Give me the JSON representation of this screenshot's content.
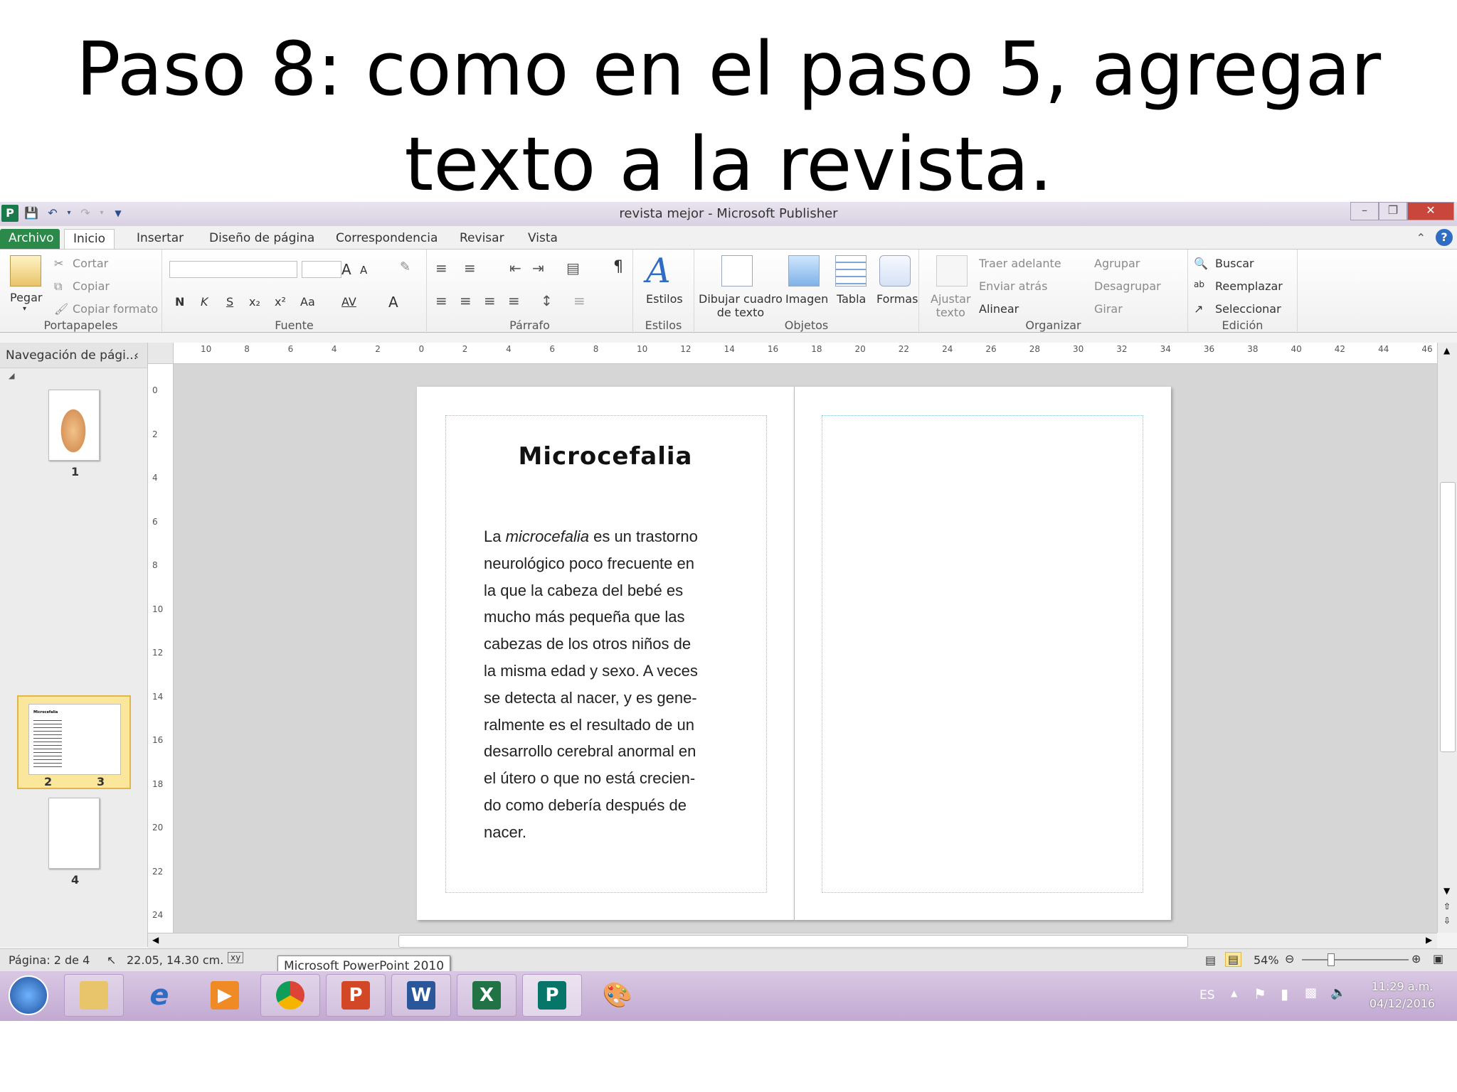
{
  "slide": {
    "title_line1": "Paso 8: como en el paso 5, agregar",
    "title_line2": "texto a la revista."
  },
  "window": {
    "title": "revista mejor  -  Microsoft Publisher"
  },
  "tabs": [
    "Archivo",
    "Inicio",
    "Insertar",
    "Diseño de página",
    "Correspondencia",
    "Revisar",
    "Vista"
  ],
  "ribbon": {
    "portapapeles": {
      "label": "Portapapeles",
      "pegar": "Pegar",
      "cortar": "Cortar",
      "copiar": "Copiar",
      "copiar_formato": "Copiar formato"
    },
    "fuente": {
      "label": "Fuente",
      "bold": "N",
      "italic": "K",
      "underline": "S",
      "subscript": "x₂",
      "superscript": "x²",
      "change_case": "Aa",
      "spacing": "AV",
      "grow": "A",
      "shrink": "A",
      "font_color": "A"
    },
    "parrafo": {
      "label": "Párrafo",
      "pilcrow": "¶"
    },
    "estilos": {
      "label": "Estilos",
      "button": "Estilos"
    },
    "objetos": {
      "label": "Objetos",
      "dibujar_cuadro_l1": "Dibujar cuadro",
      "dibujar_cuadro_l2": "de texto",
      "imagen": "Imagen",
      "tabla": "Tabla",
      "formas": "Formas"
    },
    "organizar": {
      "label": "Organizar",
      "ajustar_l1": "Ajustar",
      "ajustar_l2": "texto",
      "traer_adelante": "Traer adelante",
      "enviar_atras": "Enviar atrás",
      "alinear": "Alinear",
      "agrupar": "Agrupar",
      "desagrupar": "Desagrupar",
      "girar": "Girar"
    },
    "edicion": {
      "label": "Edición",
      "buscar": "Buscar",
      "reemplazar": "Reemplazar",
      "seleccionar": "Seleccionar"
    }
  },
  "nav": {
    "header": "Navegación de pági...",
    "page1": "1",
    "page2": "2",
    "page3": "3",
    "page4": "4",
    "thumb_title": "Microcefalia"
  },
  "hruler_labels": [
    "10",
    "8",
    "6",
    "4",
    "2",
    "0",
    "2",
    "4",
    "6",
    "8",
    "10",
    "12",
    "14",
    "16",
    "18",
    "20",
    "22",
    "24",
    "26",
    "28",
    "30",
    "32",
    "34",
    "36",
    "38",
    "40",
    "42",
    "44",
    "46"
  ],
  "vruler_labels": [
    "0",
    "2",
    "4",
    "6",
    "8",
    "10",
    "12",
    "14",
    "16",
    "18",
    "20",
    "22",
    "24"
  ],
  "document": {
    "heading": "Microcefalia",
    "body_before_italic": "La ",
    "body_italic": "microcefalia",
    "body_lines": [
      " es un trastorno",
      "neurológico poco frecuente en",
      "la que la cabeza del bebé es",
      "mucho más pequeña que las",
      "cabezas de los otros niños de",
      "la misma edad y sexo. A veces",
      "se detecta al nacer, y es gene-",
      "ralmente es el resultado de un",
      "desarrollo cerebral anormal en",
      "el útero o que no está crecien-",
      "do como debería después de",
      "nacer."
    ]
  },
  "status": {
    "page": "Página: 2 de 4",
    "position": "22.05, 14.30 cm.",
    "tooltip": "Microsoft PowerPoint 2010",
    "zoom": "54%"
  },
  "taskbar": {
    "lang": "ES",
    "time": "11:29 a.m.",
    "date": "04/12/2016"
  },
  "colors": {
    "publisher_green": "#2b8a4a",
    "taskbar": "#c2a9d2",
    "selected_thumb": "#fbe79c"
  }
}
